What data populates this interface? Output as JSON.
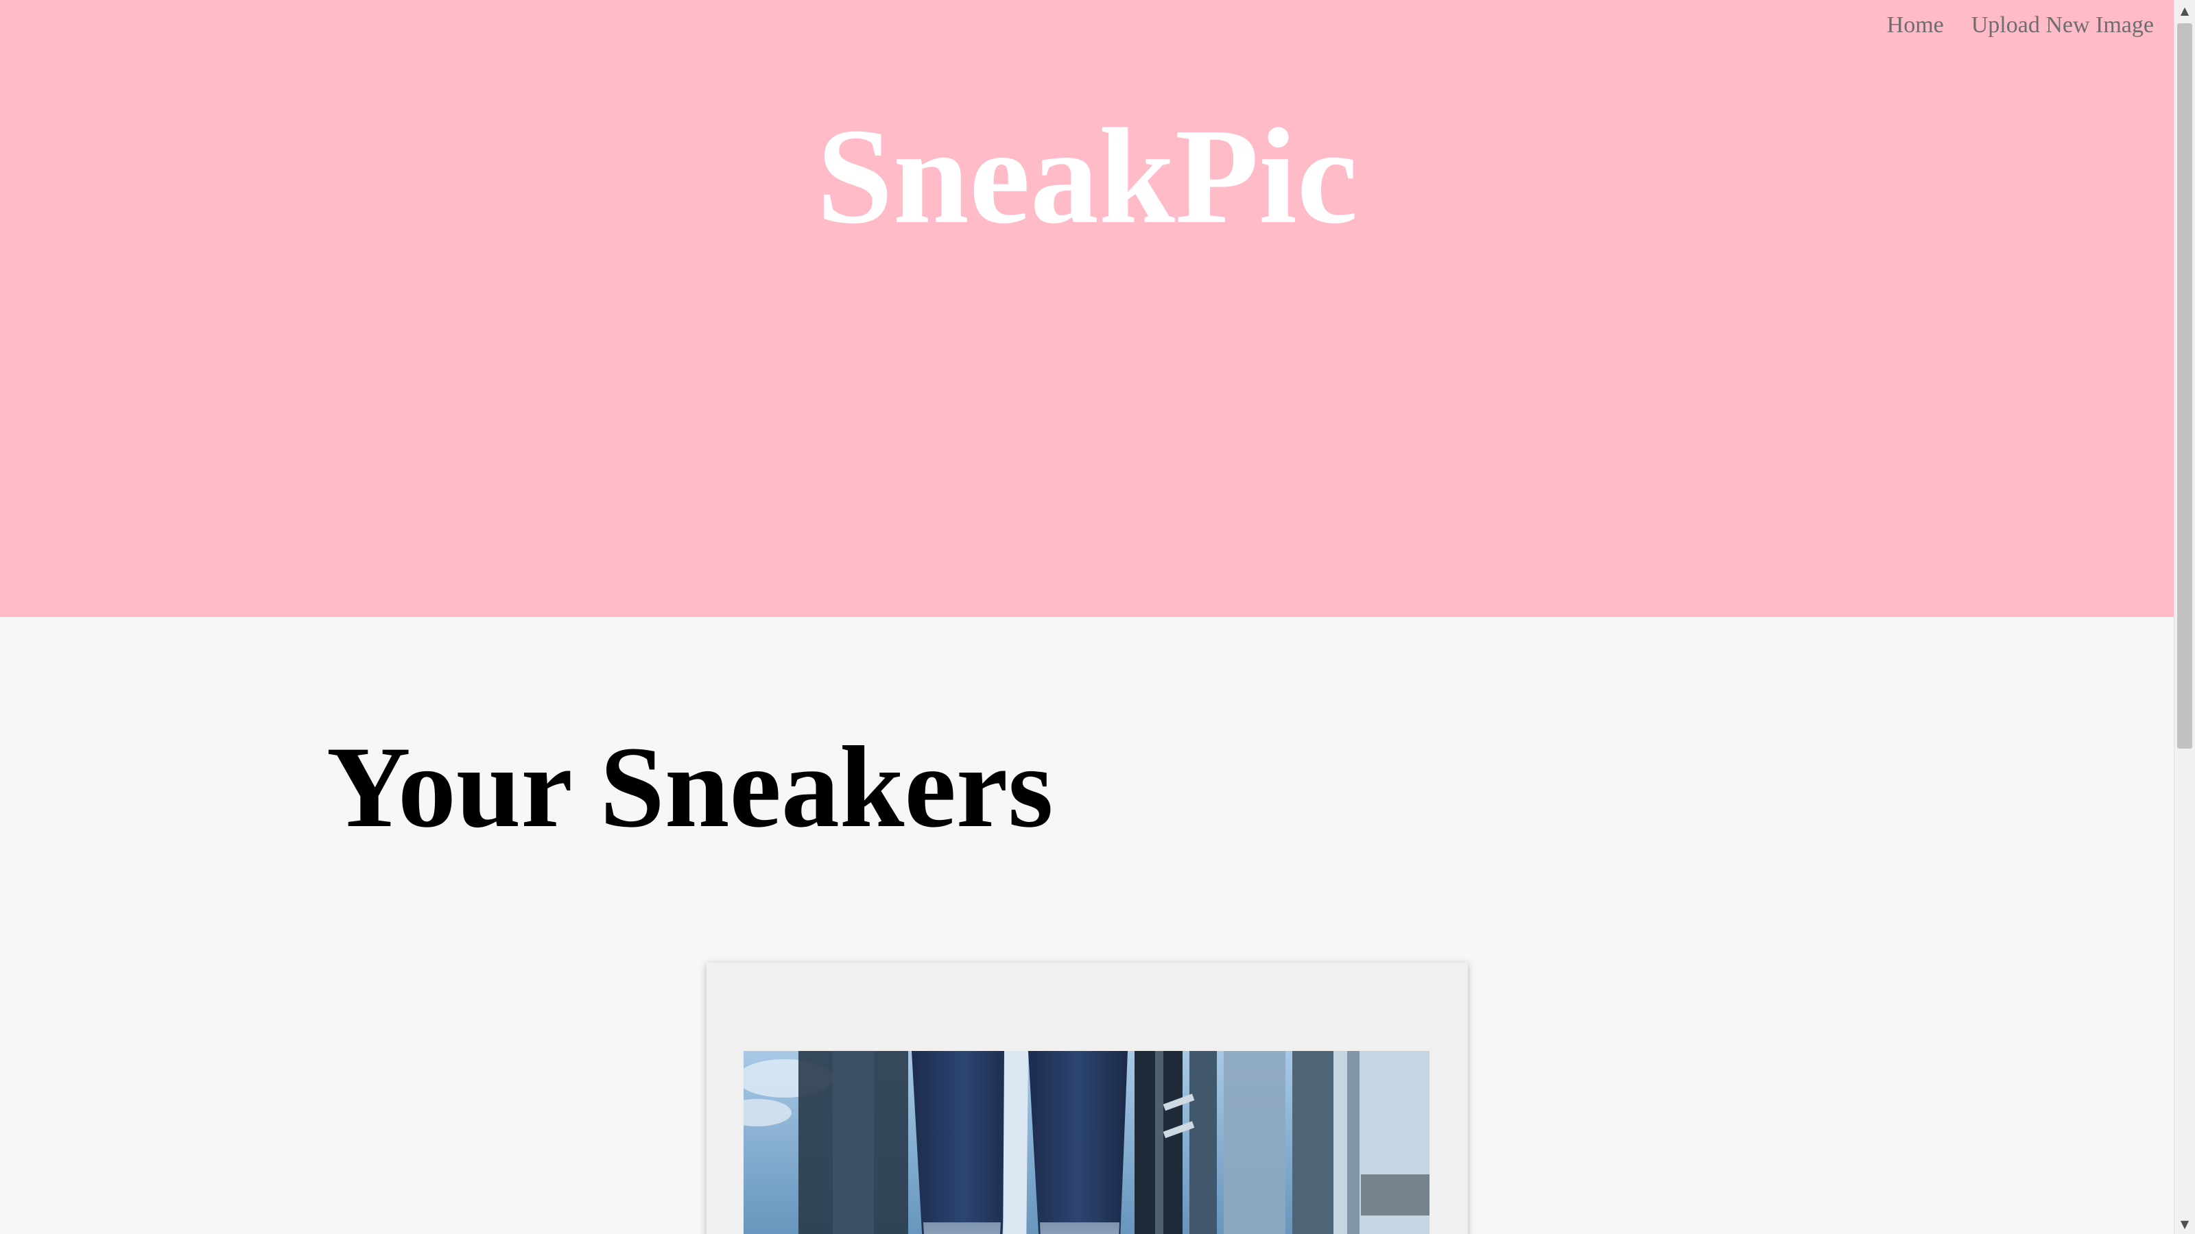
{
  "nav": {
    "home_label": "Home",
    "upload_label": "Upload New Image"
  },
  "hero": {
    "title": "SneakPic"
  },
  "main": {
    "section_title": "Your Sneakers"
  },
  "colors": {
    "hero_background": "#ffbbc7",
    "page_background": "#f7f7f7",
    "card_background": "#f0f0f0",
    "nav_link": "#6e6e6e"
  },
  "icons": {
    "scroll_up": "scroll-up-arrow-icon",
    "scroll_down": "scroll-down-arrow-icon"
  }
}
